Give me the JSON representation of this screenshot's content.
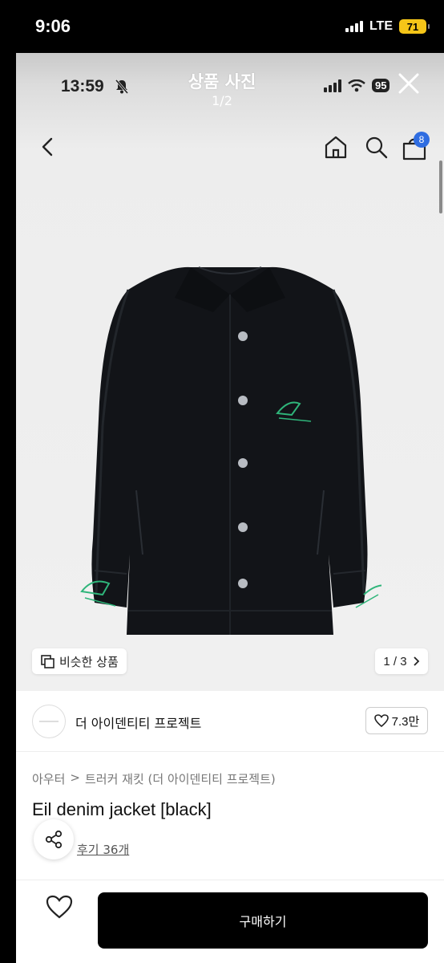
{
  "outer_status": {
    "time": "9:06",
    "network": "LTE",
    "battery": "71"
  },
  "inner_status": {
    "time": "13:59",
    "battery": "95"
  },
  "viewer": {
    "title": "상품 사진",
    "counter": "1/2"
  },
  "nav": {
    "cart_badge": "8"
  },
  "gallery": {
    "similar_label": "비슷한 상품",
    "page_indicator": "1 / 3"
  },
  "brand": {
    "name": "더 아이덴티티 프로젝트",
    "likes": "7.3만"
  },
  "breadcrumb": {
    "category": "아우터",
    "separator": ">",
    "subcategory": "트러커 재킷 (더 아이덴티티 프로젝트)"
  },
  "product": {
    "title": "Eil denim jacket [black]",
    "reviews": "후기 36개"
  },
  "actions": {
    "buy_label": "구매하기"
  },
  "colors": {
    "accent": "#2f6de1",
    "embroidery": "#2fb57a",
    "buy_bg": "#000000",
    "battery": "#f5c518"
  },
  "icons": [
    "signal-bars-icon",
    "battery-icon",
    "bell-muted-icon",
    "wifi-icon",
    "close-icon",
    "back-icon",
    "home-icon",
    "search-icon",
    "bag-icon",
    "similar-icon",
    "chevron-right-icon",
    "heart-icon",
    "share-icon"
  ]
}
